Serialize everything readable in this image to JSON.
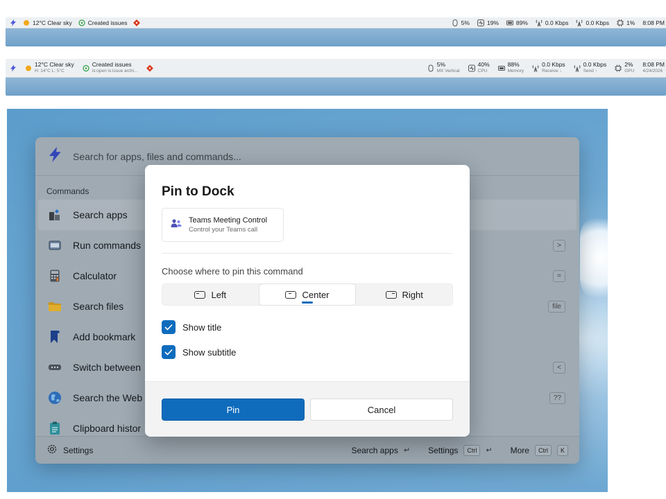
{
  "dock_compact": {
    "left": [
      {
        "icon": "command-palette-icon",
        "label": ""
      },
      {
        "icon": "sun-icon",
        "label": "12°C Clear sky"
      },
      {
        "icon": "issue-icon",
        "label": "Created issues"
      },
      {
        "icon": "git-icon",
        "label": ""
      }
    ],
    "right": [
      {
        "icon": "mouse-icon",
        "label": "5%"
      },
      {
        "icon": "cpu-icon",
        "label": "19%"
      },
      {
        "icon": "memory-icon",
        "label": "89%"
      },
      {
        "icon": "antenna-icon",
        "label": "0.0 Kbps"
      },
      {
        "icon": "antenna-icon",
        "label": "0.0 Kbps"
      },
      {
        "icon": "chip-icon",
        "label": "1%"
      },
      {
        "icon": "",
        "label": "8:08 PM"
      }
    ]
  },
  "dock_expanded": {
    "left": [
      {
        "icon": "command-palette-icon",
        "title": "",
        "sub": ""
      },
      {
        "icon": "sun-icon",
        "title": "12°C Clear sky",
        "sub": "H: 14°C  L: 5°C"
      },
      {
        "icon": "issue-icon",
        "title": "Created issues",
        "sub": "is:open is:issue archi..."
      },
      {
        "icon": "git-icon",
        "title": "",
        "sub": ""
      }
    ],
    "right": [
      {
        "icon": "mouse-icon",
        "title": "5%",
        "sub": "MX Vertical"
      },
      {
        "icon": "cpu-icon",
        "title": "40%",
        "sub": "CPU"
      },
      {
        "icon": "memory-icon",
        "title": "88%",
        "sub": "Memory"
      },
      {
        "icon": "antenna-icon",
        "title": "0.0 Kbps",
        "sub": "Receive ↓"
      },
      {
        "icon": "antenna-icon",
        "title": "0.0 Kbps",
        "sub": "Send ↑"
      },
      {
        "icon": "chip-icon",
        "title": "2%",
        "sub": "GPU"
      },
      {
        "icon": "",
        "title": "8:08 PM",
        "sub": "4/24/2026"
      }
    ]
  },
  "palette": {
    "search_placeholder": "Search for apps, files and commands...",
    "section_label": "Commands",
    "commands": [
      {
        "label": "Search apps",
        "icon": "apps-icon",
        "shortcut": ""
      },
      {
        "label": "Run commands",
        "icon": "terminal-icon",
        "shortcut": ">"
      },
      {
        "label": "Calculator",
        "icon": "calculator-icon",
        "shortcut": "="
      },
      {
        "label": "Search files",
        "icon": "folder-icon",
        "shortcut": "file"
      },
      {
        "label": "Add bookmark",
        "icon": "bookmark-icon",
        "shortcut": ""
      },
      {
        "label": "Switch between",
        "icon": "window-switch-icon",
        "shortcut": "<"
      },
      {
        "label": "Search the Web",
        "icon": "globe-icon",
        "shortcut": "??"
      },
      {
        "label": "Clipboard histor",
        "icon": "clipboard-icon",
        "shortcut": ""
      }
    ],
    "footer": {
      "settings_label": "Settings",
      "search_apps_label": "Search apps",
      "settings_right_label": "Settings",
      "ctrl_key": "Ctrl",
      "more_label": "More",
      "k_key": "K",
      "return_glyph": "↵"
    }
  },
  "dialog": {
    "title": "Pin to Dock",
    "card_title": "Teams Meeting Control",
    "card_subtitle": "Control your Teams call",
    "choose_label": "Choose where to pin this command",
    "positions": [
      "Left",
      "Center",
      "Right"
    ],
    "selected_position": "Center",
    "show_title_label": "Show title",
    "show_title_checked": true,
    "show_subtitle_label": "Show subtitle",
    "show_subtitle_checked": true,
    "pin_label": "Pin",
    "cancel_label": "Cancel"
  },
  "colors": {
    "accent": "#0f6cbd",
    "dock_bar": "#edf0f3",
    "palette_dimmed": "#9faab3"
  }
}
